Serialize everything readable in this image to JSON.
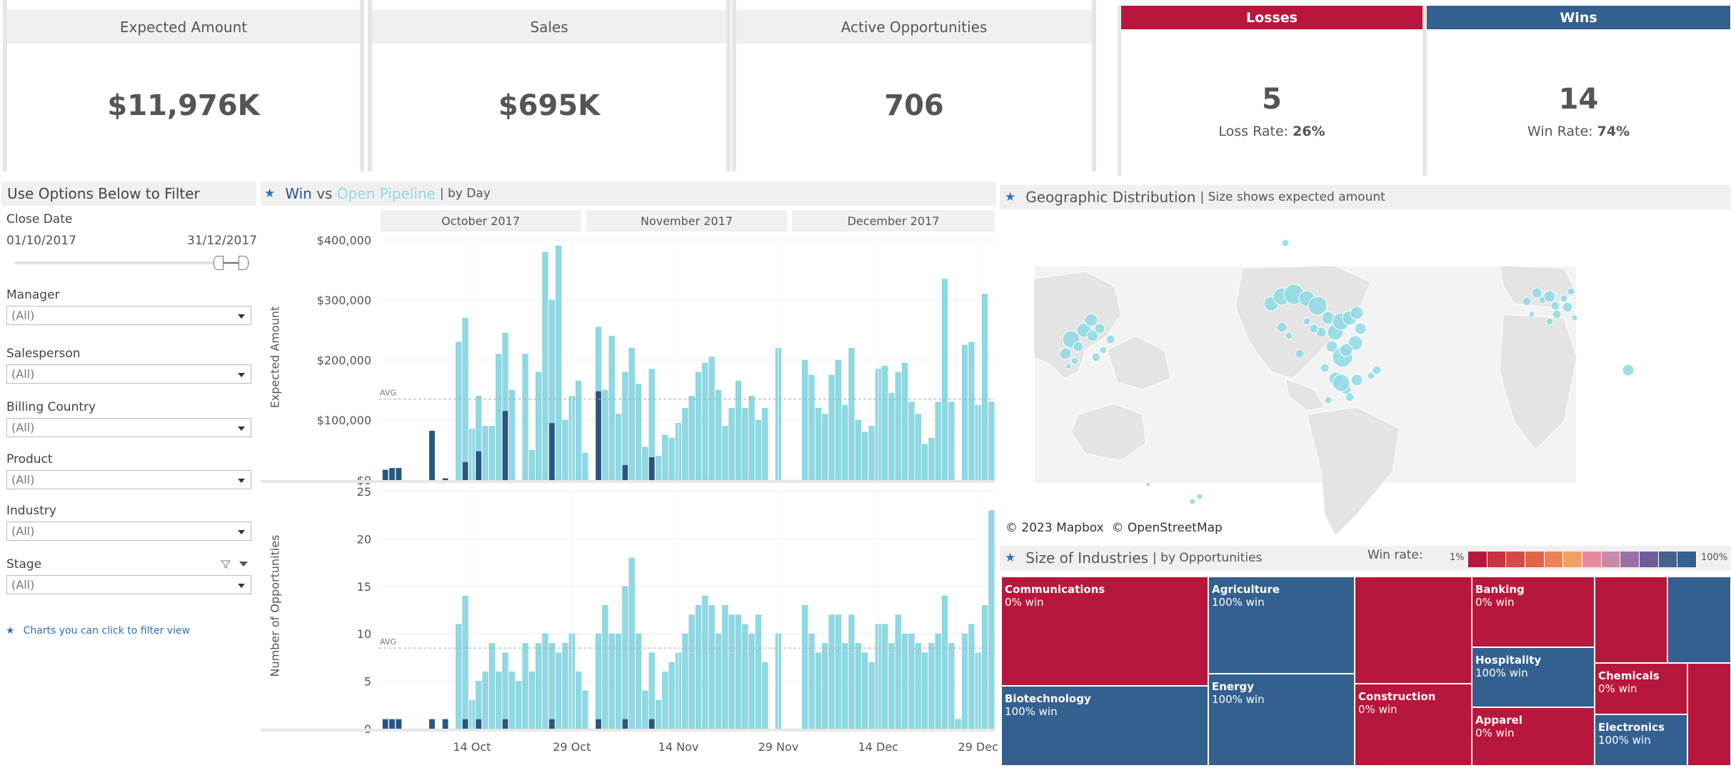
{
  "kpis": [
    {
      "label": "Expected Amount",
      "value": "$11,976K"
    },
    {
      "label": "Sales",
      "value": "$695K"
    },
    {
      "label": "Active Opportunities",
      "value": "706"
    }
  ],
  "losses": {
    "header": "Losses",
    "count": "5",
    "rate_label": "Loss Rate:",
    "rate": "26%",
    "color": "#b8173d"
  },
  "wins": {
    "header": "Wins",
    "count": "14",
    "rate_label": "Win Rate:",
    "rate": "74%",
    "color": "#33608f"
  },
  "filters": {
    "title": "Use Options Below to Filter",
    "close_date": {
      "label": "Close Date",
      "start": "01/10/2017",
      "end": "31/12/2017"
    },
    "dropdowns": [
      {
        "label": "Manager",
        "value": "(All)"
      },
      {
        "label": "Salesperson",
        "value": "(All)"
      },
      {
        "label": "Billing Country",
        "value": "(All)"
      },
      {
        "label": "Product",
        "value": "(All)"
      },
      {
        "label": "Industry",
        "value": "(All)"
      },
      {
        "label": "Stage",
        "value": "(All)"
      }
    ],
    "hint": "Charts you can click to filter view"
  },
  "win_chart": {
    "title_win": "Win",
    "title_vs": "vs",
    "title_pipeline": "Open Pipeline",
    "title_sub": "| by Day",
    "months": [
      "October 2017",
      "November 2017",
      "December 2017"
    ],
    "top_ylabel": "Expected Amount",
    "bottom_ylabel": "Number of Opportunities",
    "avg_label": "AVG",
    "top_ticks": [
      "$400,000",
      "$300,000",
      "$200,000",
      "$100,000",
      "$0"
    ],
    "bottom_ticks": [
      "25",
      "20",
      "15",
      "10",
      "5",
      "0"
    ],
    "x_ticks": [
      "14 Oct",
      "29 Oct",
      "14 Nov",
      "29 Nov",
      "14 Dec",
      "29 Dec"
    ],
    "pipeline_color": "#8ed9e3",
    "win_color": "#2a5580"
  },
  "chart_data": {
    "type": "bar",
    "x": [
      "2017-10-01",
      "2017-10-02",
      "2017-10-03",
      "2017-10-04",
      "2017-10-05",
      "2017-10-06",
      "2017-10-07",
      "2017-10-08",
      "2017-10-09",
      "2017-10-10",
      "2017-10-11",
      "2017-10-12",
      "2017-10-13",
      "2017-10-14",
      "2017-10-15",
      "2017-10-16",
      "2017-10-17",
      "2017-10-18",
      "2017-10-19",
      "2017-10-20",
      "2017-10-21",
      "2017-10-22",
      "2017-10-23",
      "2017-10-24",
      "2017-10-25",
      "2017-10-26",
      "2017-10-27",
      "2017-10-28",
      "2017-10-29",
      "2017-10-30",
      "2017-10-31",
      "2017-11-01",
      "2017-11-02",
      "2017-11-03",
      "2017-11-04",
      "2017-11-05",
      "2017-11-06",
      "2017-11-07",
      "2017-11-08",
      "2017-11-09",
      "2017-11-10",
      "2017-11-11",
      "2017-11-12",
      "2017-11-13",
      "2017-11-14",
      "2017-11-15",
      "2017-11-16",
      "2017-11-17",
      "2017-11-18",
      "2017-11-19",
      "2017-11-20",
      "2017-11-21",
      "2017-11-22",
      "2017-11-23",
      "2017-11-24",
      "2017-11-25",
      "2017-11-26",
      "2017-11-27",
      "2017-11-28",
      "2017-11-29",
      "2017-11-30",
      "2017-12-01",
      "2017-12-02",
      "2017-12-03",
      "2017-12-04",
      "2017-12-05",
      "2017-12-06",
      "2017-12-07",
      "2017-12-08",
      "2017-12-09",
      "2017-12-10",
      "2017-12-11",
      "2017-12-12",
      "2017-12-13",
      "2017-12-14",
      "2017-12-15",
      "2017-12-16",
      "2017-12-17",
      "2017-12-18",
      "2017-12-19",
      "2017-12-20",
      "2017-12-21",
      "2017-12-22",
      "2017-12-23",
      "2017-12-24",
      "2017-12-25",
      "2017-12-26",
      "2017-12-27",
      "2017-12-28",
      "2017-12-29",
      "2017-12-30",
      "2017-12-31"
    ],
    "series": [
      {
        "name": "Open Pipeline",
        "chart": "Expected Amount",
        "values": [
          17000,
          20000,
          20000,
          0,
          0,
          0,
          0,
          82000,
          0,
          0,
          0,
          230000,
          270000,
          85000,
          140000,
          90000,
          90000,
          210000,
          245000,
          150000,
          0,
          210000,
          50000,
          180000,
          380000,
          300000,
          390000,
          100000,
          140000,
          165000,
          45000,
          0,
          255000,
          150000,
          240000,
          110000,
          180000,
          220000,
          160000,
          55000,
          185000,
          40000,
          75000,
          70000,
          95000,
          120000,
          140000,
          180000,
          195000,
          205000,
          150000,
          90000,
          120000,
          165000,
          120000,
          140000,
          100000,
          120000,
          0,
          220000,
          0,
          0,
          0,
          200000,
          175000,
          120000,
          110000,
          175000,
          200000,
          125000,
          220000,
          100000,
          80000,
          90000,
          185000,
          190000,
          145000,
          180000,
          195000,
          130000,
          110000,
          60000,
          70000,
          130000,
          335000,
          130000,
          0,
          225000,
          230000,
          125000,
          310000,
          130000
        ]
      },
      {
        "name": "Win",
        "chart": "Expected Amount",
        "values": [
          17000,
          20000,
          20000,
          0,
          0,
          0,
          0,
          82000,
          0,
          3000,
          0,
          0,
          30000,
          0,
          48000,
          0,
          0,
          0,
          115000,
          0,
          0,
          0,
          0,
          0,
          0,
          95000,
          0,
          0,
          0,
          0,
          0,
          0,
          148000,
          0,
          0,
          0,
          25000,
          0,
          0,
          0,
          38000,
          0,
          0,
          0,
          0,
          0,
          0,
          0,
          0,
          0,
          0,
          0,
          0,
          0,
          0,
          0,
          0,
          0,
          0,
          0,
          0,
          0,
          0,
          0,
          0,
          0,
          0,
          0,
          0,
          0,
          0,
          0,
          0,
          0,
          0,
          0,
          0,
          0,
          0,
          0,
          0,
          0,
          0,
          0,
          0,
          0,
          0,
          0,
          0,
          0,
          0,
          0
        ]
      },
      {
        "name": "Open Pipeline",
        "chart": "Number of Opportunities",
        "values": [
          1,
          1,
          1,
          0,
          0,
          0,
          0,
          1,
          0,
          1,
          0,
          11,
          14,
          3,
          5,
          6,
          9,
          6,
          8,
          6,
          5,
          9,
          6,
          9,
          10,
          9,
          8,
          9,
          10,
          6,
          4,
          0,
          10,
          13,
          10,
          10,
          15,
          18,
          10,
          4,
          8,
          3,
          6,
          7,
          8,
          10,
          12,
          13,
          14,
          13,
          10,
          13,
          12,
          12,
          11,
          10,
          12,
          7,
          0,
          10,
          0,
          0,
          0,
          13,
          10,
          8,
          9,
          12,
          12,
          9,
          12,
          9,
          8,
          7,
          11,
          11,
          9,
          12,
          10,
          10,
          9,
          8,
          9,
          10,
          14,
          9,
          1,
          10,
          11,
          8,
          13,
          23
        ]
      },
      {
        "name": "Win",
        "chart": "Number of Opportunities",
        "values": [
          1,
          1,
          1,
          0,
          0,
          0,
          0,
          1,
          0,
          1,
          0,
          0,
          1,
          0,
          1,
          0,
          0,
          0,
          1,
          0,
          0,
          0,
          0,
          0,
          0,
          1,
          0,
          0,
          0,
          0,
          0,
          0,
          1,
          0,
          0,
          0,
          1,
          0,
          0,
          0,
          1,
          0,
          0,
          0,
          0,
          0,
          0,
          0,
          0,
          0,
          0,
          0,
          0,
          0,
          0,
          0,
          0,
          0,
          0,
          0,
          0,
          0,
          0,
          0,
          0,
          0,
          0,
          0,
          0,
          0,
          0,
          0,
          0,
          0,
          0,
          0,
          0,
          0,
          0,
          0,
          0,
          0,
          0,
          0,
          0,
          0,
          0,
          0,
          0,
          0,
          0,
          0
        ]
      }
    ],
    "ylim_amount": [
      0,
      400000
    ],
    "ylim_count": [
      0,
      25
    ],
    "avg_amount": 135000,
    "avg_count": 8.5
  },
  "geo": {
    "title": "Geographic Distribution",
    "sub": "| Size shows expected amount",
    "attribution": "© 2023 Mapbox  © OpenStreetMap",
    "point_color": "#8ed9e3"
  },
  "industries": {
    "title": "Size of Industries",
    "sub": "| by Opportunities",
    "win_rate_label": "Win rate:",
    "scale_min": "1%",
    "scale_max": "100%",
    "scale_colors": [
      "#b8173d",
      "#c9323f",
      "#d44a48",
      "#e0634a",
      "#ec8250",
      "#f2a061",
      "#e58a9c",
      "#c78aa8",
      "#9c6fa6",
      "#6a5f99",
      "#45608f",
      "#33608f"
    ],
    "items": [
      {
        "name": "Communications",
        "win": "0% win",
        "color": "red"
      },
      {
        "name": "Agriculture",
        "win": "100% win",
        "color": "blue"
      },
      {
        "name": "Banking",
        "win": "0% win",
        "color": "red"
      },
      {
        "name": "Biotechnology",
        "win": "100% win",
        "color": "blue"
      },
      {
        "name": "Energy",
        "win": "100% win",
        "color": "blue"
      },
      {
        "name": "Construction",
        "win": "0% win",
        "color": "red"
      },
      {
        "name": "Hospitality",
        "win": "100% win",
        "color": "blue"
      },
      {
        "name": "Chemicals",
        "win": "0% win",
        "color": "red"
      },
      {
        "name": "Apparel",
        "win": "0% win",
        "color": "red"
      },
      {
        "name": "Electronics",
        "win": "100% win",
        "color": "blue"
      }
    ]
  }
}
